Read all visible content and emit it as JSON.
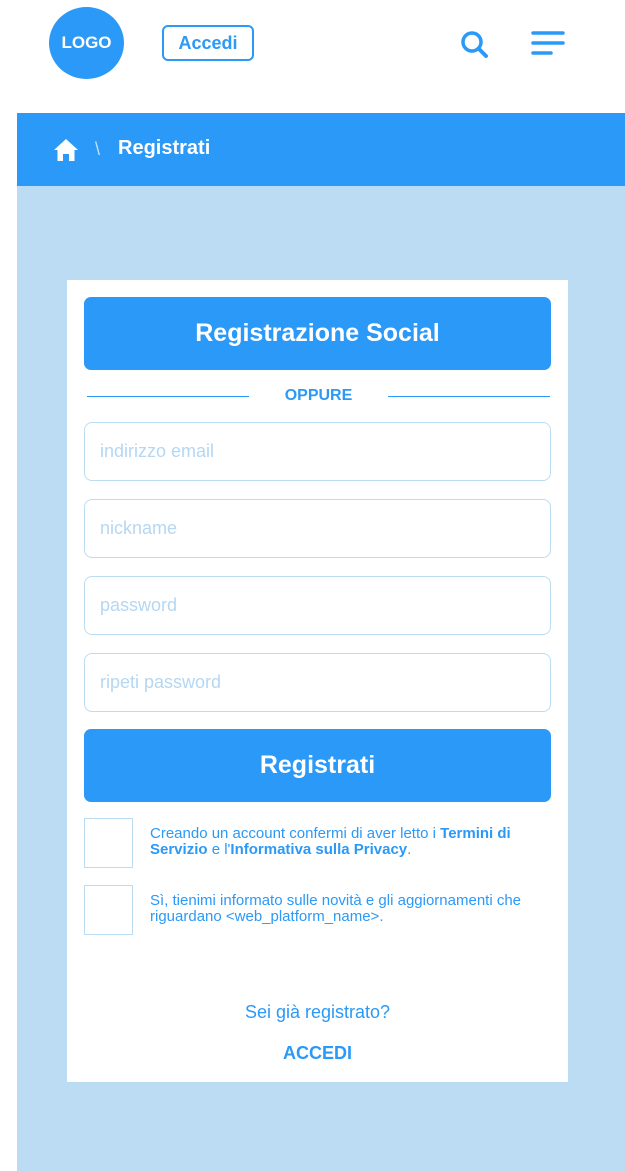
{
  "header": {
    "logo_text": "LOGO",
    "login_button": "Accedi",
    "search_icon": "search-icon",
    "menu_icon": "menu-icon"
  },
  "breadcrumb": {
    "home_icon": "home-icon",
    "separator": "\\",
    "current": "Registrati"
  },
  "form": {
    "social_button": "Registrazione Social",
    "divider_text": "OPPURE",
    "fields": [
      {
        "placeholder": "indirizzo email",
        "value": ""
      },
      {
        "placeholder": "nickname",
        "value": ""
      },
      {
        "placeholder": "password",
        "value": ""
      },
      {
        "placeholder": "ripeti password",
        "value": ""
      }
    ],
    "submit_button": "Registrati",
    "consents": [
      {
        "checked": false,
        "text_before": "Creando un account confermi di aver letto i ",
        "link1": "Termini di Servizio",
        "text_middle": " e l'",
        "link2": "Informativa sulla Privacy",
        "text_after": "."
      },
      {
        "checked": false,
        "text": "Sì, tienimi informato sulle novità e gli aggiornamenti che riguardano <web_platform_name>."
      }
    ],
    "already_registered": "Sei già registrato?",
    "login_link": "ACCEDI"
  },
  "colors": {
    "primary": "#2b99f7",
    "page_background": "#bcdcf3",
    "card_background": "#ffffff",
    "field_border": "#bcdcf3"
  }
}
